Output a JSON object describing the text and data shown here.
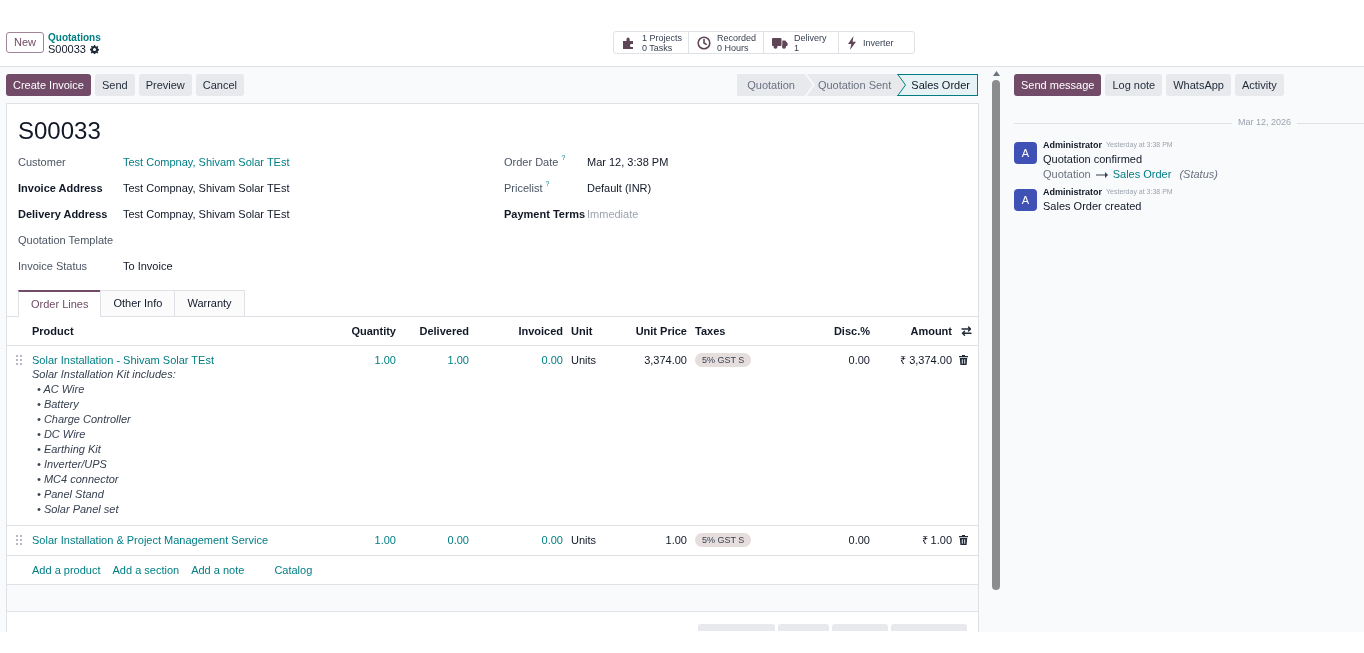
{
  "header": {
    "new_button": "New",
    "breadcrumb": "Quotations",
    "record": "S00033"
  },
  "smart_buttons": [
    {
      "lines": [
        "1 Projects",
        "0 Tasks"
      ]
    },
    {
      "lines": [
        "Recorded",
        "0 Hours"
      ]
    },
    {
      "lines": [
        "Delivery",
        "1"
      ]
    },
    {
      "lines": [
        "Inverter"
      ]
    }
  ],
  "actions": [
    {
      "label": "Create Invoice",
      "primary": true
    },
    {
      "label": "Send",
      "primary": false
    },
    {
      "label": "Preview",
      "primary": false
    },
    {
      "label": "Cancel",
      "primary": false
    }
  ],
  "status_bar": [
    {
      "label": "Quotation",
      "selected": false
    },
    {
      "label": "Quotation Sent",
      "selected": false
    },
    {
      "label": "Sales Order",
      "selected": true
    }
  ],
  "form": {
    "title": "S00033",
    "fields_left": [
      {
        "label": "Customer",
        "value": "Test Compnay, Shivam Solar TEst",
        "kind": "link",
        "emphasized": false
      },
      {
        "label": "Invoice Address",
        "value": "Test Compnay, Shivam Solar TEst",
        "kind": "text",
        "emphasized": true
      },
      {
        "label": "Delivery Address",
        "value": "Test Compnay, Shivam Solar TEst",
        "kind": "text",
        "emphasized": true
      },
      {
        "label": "Quotation Template",
        "emphasized": false
      },
      {
        "label": "Invoice Status",
        "value": "To Invoice",
        "kind": "text",
        "emphasized": false
      }
    ],
    "fields_right": [
      {
        "label": "Order Date",
        "help": "?",
        "value": "Mar 12, 3:38 PM",
        "kind": "text",
        "emphasized": false
      },
      {
        "label": "Pricelist",
        "help": "?",
        "value": "Default (INR)",
        "kind": "text",
        "emphasized": false
      },
      {
        "label": "Payment Terms",
        "placeholder": "Immediate",
        "emphasized": true
      }
    ]
  },
  "tabs": [
    {
      "label": "Order Lines",
      "selected": true
    },
    {
      "label": "Other Info",
      "selected": false
    },
    {
      "label": "Warranty",
      "selected": false
    }
  ],
  "order_lines": {
    "columns": [
      "Product",
      "Quantity",
      "Delivered",
      "Invoiced",
      "Unit",
      "Unit Price",
      "Taxes",
      "Disc.%",
      "Amount"
    ],
    "rows": [
      {
        "product": "Solar Installation - Shivam Solar TEst",
        "description": {
          "intro": "Solar Installation Kit includes:",
          "items": [
            "• AC Wire",
            "• Battery",
            "• Charge Controller",
            "• DC Wire",
            "• Earthing Kit",
            "• Inverter/UPS",
            "• MC4 connector",
            "• Panel Stand",
            "• Solar Panel set"
          ]
        },
        "quantity": "1.00",
        "delivered": "1.00",
        "invoiced": "0.00",
        "unit": "Units",
        "unit_price": "3,374.00",
        "taxes": [
          "5% GST S"
        ],
        "discount": "0.00",
        "amount": "₹ 3,374.00"
      },
      {
        "product": "Solar Installation & Project Management Service",
        "quantity": "1.00",
        "delivered": "0.00",
        "invoiced": "0.00",
        "unit": "Units",
        "unit_price": "1.00",
        "taxes": [
          "5% GST S"
        ],
        "discount": "0.00",
        "amount": "₹ 1.00"
      }
    ],
    "add_links": [
      "Add a product",
      "Add a section",
      "Add a note",
      "Catalog"
    ]
  },
  "footer_buttons": [
    {
      "kind": "button"
    },
    {
      "kind": "button"
    },
    {
      "kind": "button"
    },
    {
      "kind": "button"
    }
  ],
  "chatter": {
    "buttons": [
      {
        "label": "Send message",
        "primary": true
      },
      {
        "label": "Log note",
        "primary": false
      },
      {
        "label": "WhatsApp",
        "primary": false
      },
      {
        "label": "Activity",
        "primary": false
      }
    ],
    "date_separator": "Mar 12, 2026",
    "messages": [
      {
        "avatar": "A",
        "author": "Administrator",
        "time": "Yesterday at 3:38 PM",
        "body": "Quotation confirmed",
        "tracking": {
          "old": "Quotation",
          "new": "Sales Order",
          "field": "(Status)"
        }
      },
      {
        "avatar": "A",
        "author": "Administrator",
        "time": "Yesterday at 3:38 PM",
        "body": "Sales Order created"
      }
    ]
  }
}
